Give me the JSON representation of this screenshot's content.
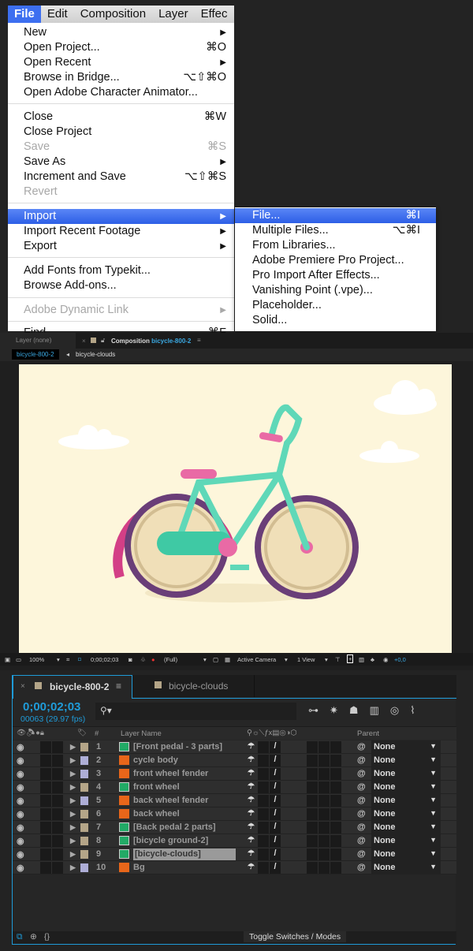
{
  "menubar": {
    "items": [
      "File",
      "Edit",
      "Composition",
      "Layer",
      "Effec"
    ]
  },
  "file_menu": [
    {
      "label": "New",
      "sub": true
    },
    {
      "label": "Open Project...",
      "shortcut": "⌘O"
    },
    {
      "label": "Open Recent",
      "sub": true
    },
    {
      "label": "Browse in Bridge...",
      "shortcut": "⌥⇧⌘O"
    },
    {
      "label": "Open Adobe Character Animator..."
    },
    {
      "label": "Close",
      "shortcut": "⌘W"
    },
    {
      "label": "Close Project"
    },
    {
      "label": "Save",
      "shortcut": "⌘S",
      "disabled": true
    },
    {
      "label": "Save As",
      "sub": true
    },
    {
      "label": "Increment and Save",
      "shortcut": "⌥⇧⌘S"
    },
    {
      "label": "Revert",
      "disabled": true
    },
    {
      "label": "Import",
      "sub": true,
      "highlighted": true
    },
    {
      "label": "Import Recent Footage",
      "sub": true
    },
    {
      "label": "Export",
      "sub": true
    },
    {
      "label": "Add Fonts from Typekit..."
    },
    {
      "label": "Browse Add-ons..."
    },
    {
      "label": "Adobe Dynamic Link",
      "sub": true,
      "disabled": true
    },
    {
      "label": "Find...",
      "shortcut": "⌘F"
    }
  ],
  "import_submenu": [
    {
      "label": "File...",
      "shortcut": "⌘I",
      "highlighted": true
    },
    {
      "label": "Multiple Files...",
      "shortcut": "⌥⌘I"
    },
    {
      "label": "From Libraries..."
    },
    {
      "label": "Adobe Premiere Pro Project..."
    },
    {
      "label": "Pro Import After Effects..."
    },
    {
      "label": "Vanishing Point (.vpe)..."
    },
    {
      "label": "Placeholder..."
    },
    {
      "label": "Solid..."
    }
  ],
  "comp_panel": {
    "layer_tab": "Layer (none)",
    "comp_tab_prefix": "Composition",
    "comp_name": "bicycle-800-2",
    "breadcrumb": [
      "bicycle-800-2",
      "bicycle-clouds"
    ]
  },
  "viewer_toolbar": {
    "zoom": "100%",
    "timecode": "0;00;02;03",
    "resolution": "(Full)",
    "camera": "Active Camera",
    "views": "1 View",
    "exposure": "+0,0"
  },
  "timeline": {
    "tabs": [
      "bicycle-800-2",
      "bicycle-clouds"
    ],
    "timecode": "0;00;02;03",
    "frame_info": "00063 (29.97 fps)",
    "col_num": "#",
    "col_name": "Layer Name",
    "col_parent": "Parent",
    "footer": "Toggle Switches / Modes",
    "layers": [
      {
        "num": "1",
        "name": "[Front pedal - 3 parts]",
        "label_color": "#b4a588",
        "type": "comp"
      },
      {
        "num": "2",
        "name": "cycle body",
        "label_color": "#aeaed6",
        "type": "ai"
      },
      {
        "num": "3",
        "name": "front wheel fender",
        "label_color": "#aeaed6",
        "type": "ai"
      },
      {
        "num": "4",
        "name": "front wheel",
        "label_color": "#b4a588",
        "type": "comp"
      },
      {
        "num": "5",
        "name": "back wheel fender",
        "label_color": "#aeaed6",
        "type": "ai"
      },
      {
        "num": "6",
        "name": "back wheel",
        "label_color": "#b4a588",
        "type": "ai"
      },
      {
        "num": "7",
        "name": "[Back pedal 2 parts]",
        "label_color": "#b4a588",
        "type": "comp"
      },
      {
        "num": "8",
        "name": "[bicycle ground-2]",
        "label_color": "#b4a588",
        "type": "comp"
      },
      {
        "num": "9",
        "name": "[bicycle-clouds]",
        "label_color": "#b4a588",
        "type": "comp",
        "selected": true
      },
      {
        "num": "10",
        "name": "Bg",
        "label_color": "#aeaed6",
        "type": "ai"
      }
    ],
    "parent_value": "None"
  },
  "colors": {
    "accent": "#1f9bd8",
    "menu_highlight": "#3d6ff0",
    "canvas": "#fdf6db"
  }
}
